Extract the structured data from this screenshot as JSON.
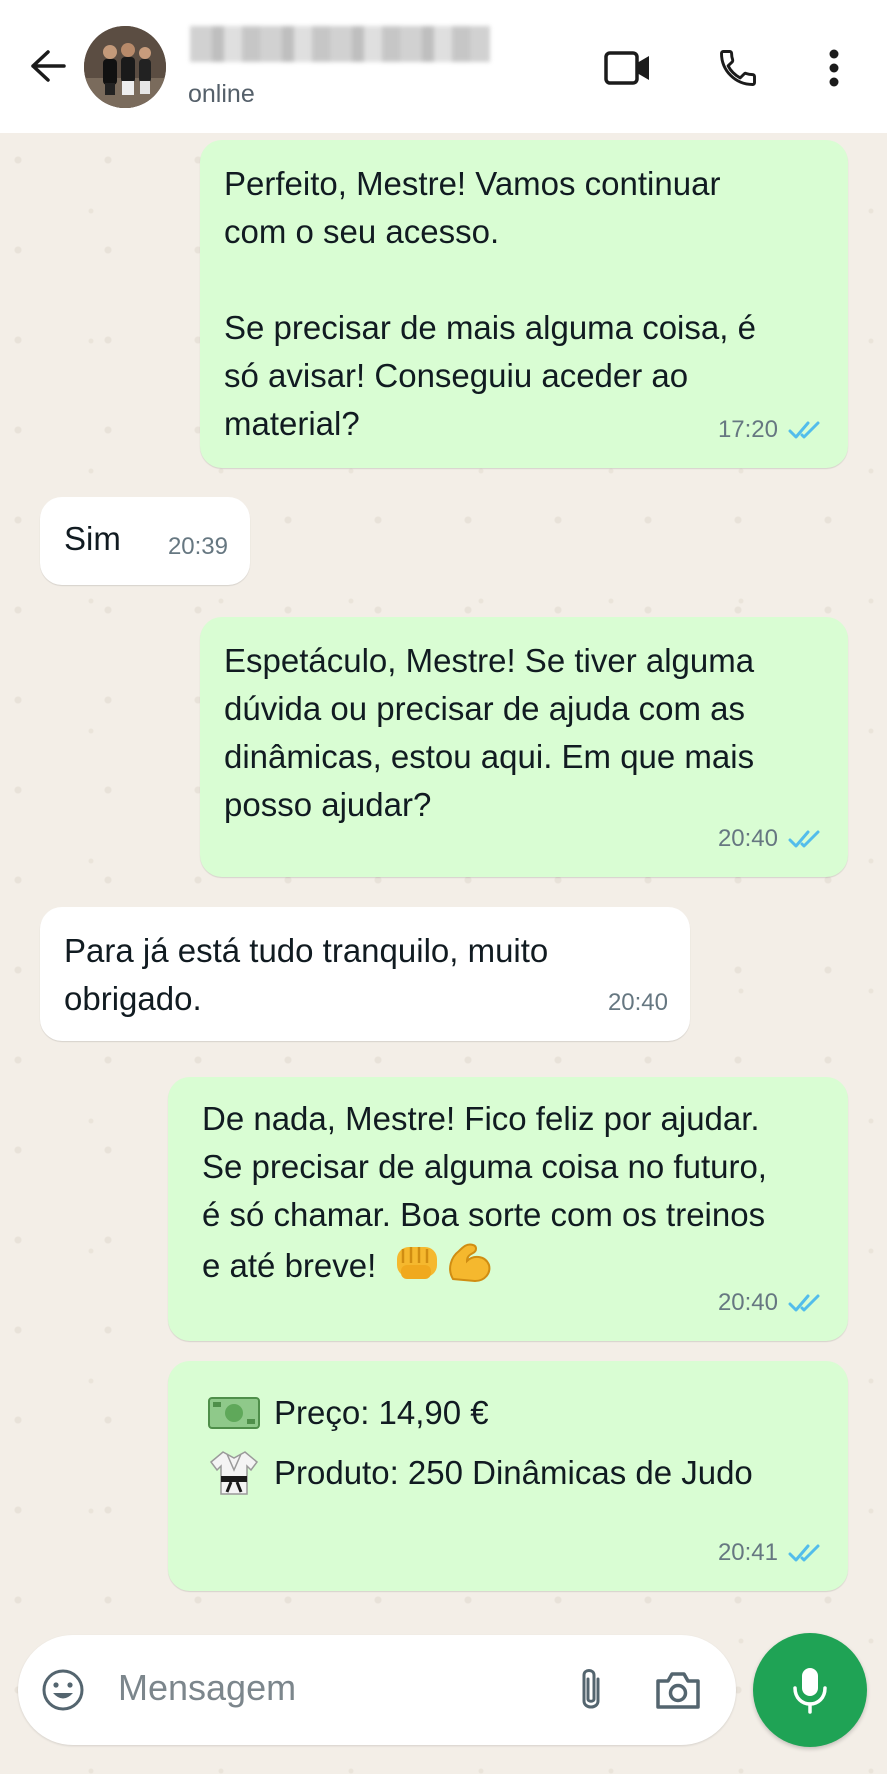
{
  "header": {
    "status": "online",
    "icons": [
      "back-arrow-icon",
      "video-call-icon",
      "voice-call-icon",
      "more-options-icon"
    ]
  },
  "messages": [
    {
      "direction": "outgoing",
      "text": "Perfeito, Mestre! Vamos continuar\ncom o seu acesso.\n\nSe precisar de mais alguma coisa, é\nsó avisar! Conseguiu aceder ao\nmaterial?",
      "time": "17:20",
      "status": "read"
    },
    {
      "direction": "incoming",
      "text": "Sim",
      "time": "20:39"
    },
    {
      "direction": "outgoing",
      "text": "Espetáculo, Mestre! Se tiver alguma\ndúvida ou precisar de ajuda com as\ndinâmicas, estou aqui. Em que mais\nposso ajudar?",
      "time": "20:40",
      "status": "read"
    },
    {
      "direction": "incoming",
      "text": "Para já está tudo tranquilo, muito\nobrigado.",
      "time": "20:40"
    },
    {
      "direction": "outgoing",
      "text": "De nada, Mestre! Fico feliz por ajudar.\nSe precisar de alguma coisa no futuro,\né só chamar. Boa sorte com os treinos\ne até breve!",
      "emojis": [
        "fist-bump-emoji",
        "flexed-biceps-emoji"
      ],
      "time": "20:40",
      "status": "read"
    },
    {
      "direction": "outgoing",
      "lines": [
        {
          "icon": "money-emoji",
          "text": "Preço: 14,90 €"
        },
        {
          "icon": "martial-arts-uniform-emoji",
          "text": "Produto: 250 Dinâmicas de Judo"
        }
      ],
      "time": "20:41",
      "status": "read"
    }
  ],
  "composer": {
    "placeholder": "Mensagem",
    "icons": [
      "emoji-icon",
      "attach-icon",
      "camera-icon",
      "microphone-icon"
    ]
  },
  "colors": {
    "outgoing_bubble": "#d9fdd3",
    "incoming_bubble": "#ffffff",
    "read_ticks": "#53bdeb",
    "mic_button": "#1fa355",
    "chat_background": "#f3eee7"
  }
}
